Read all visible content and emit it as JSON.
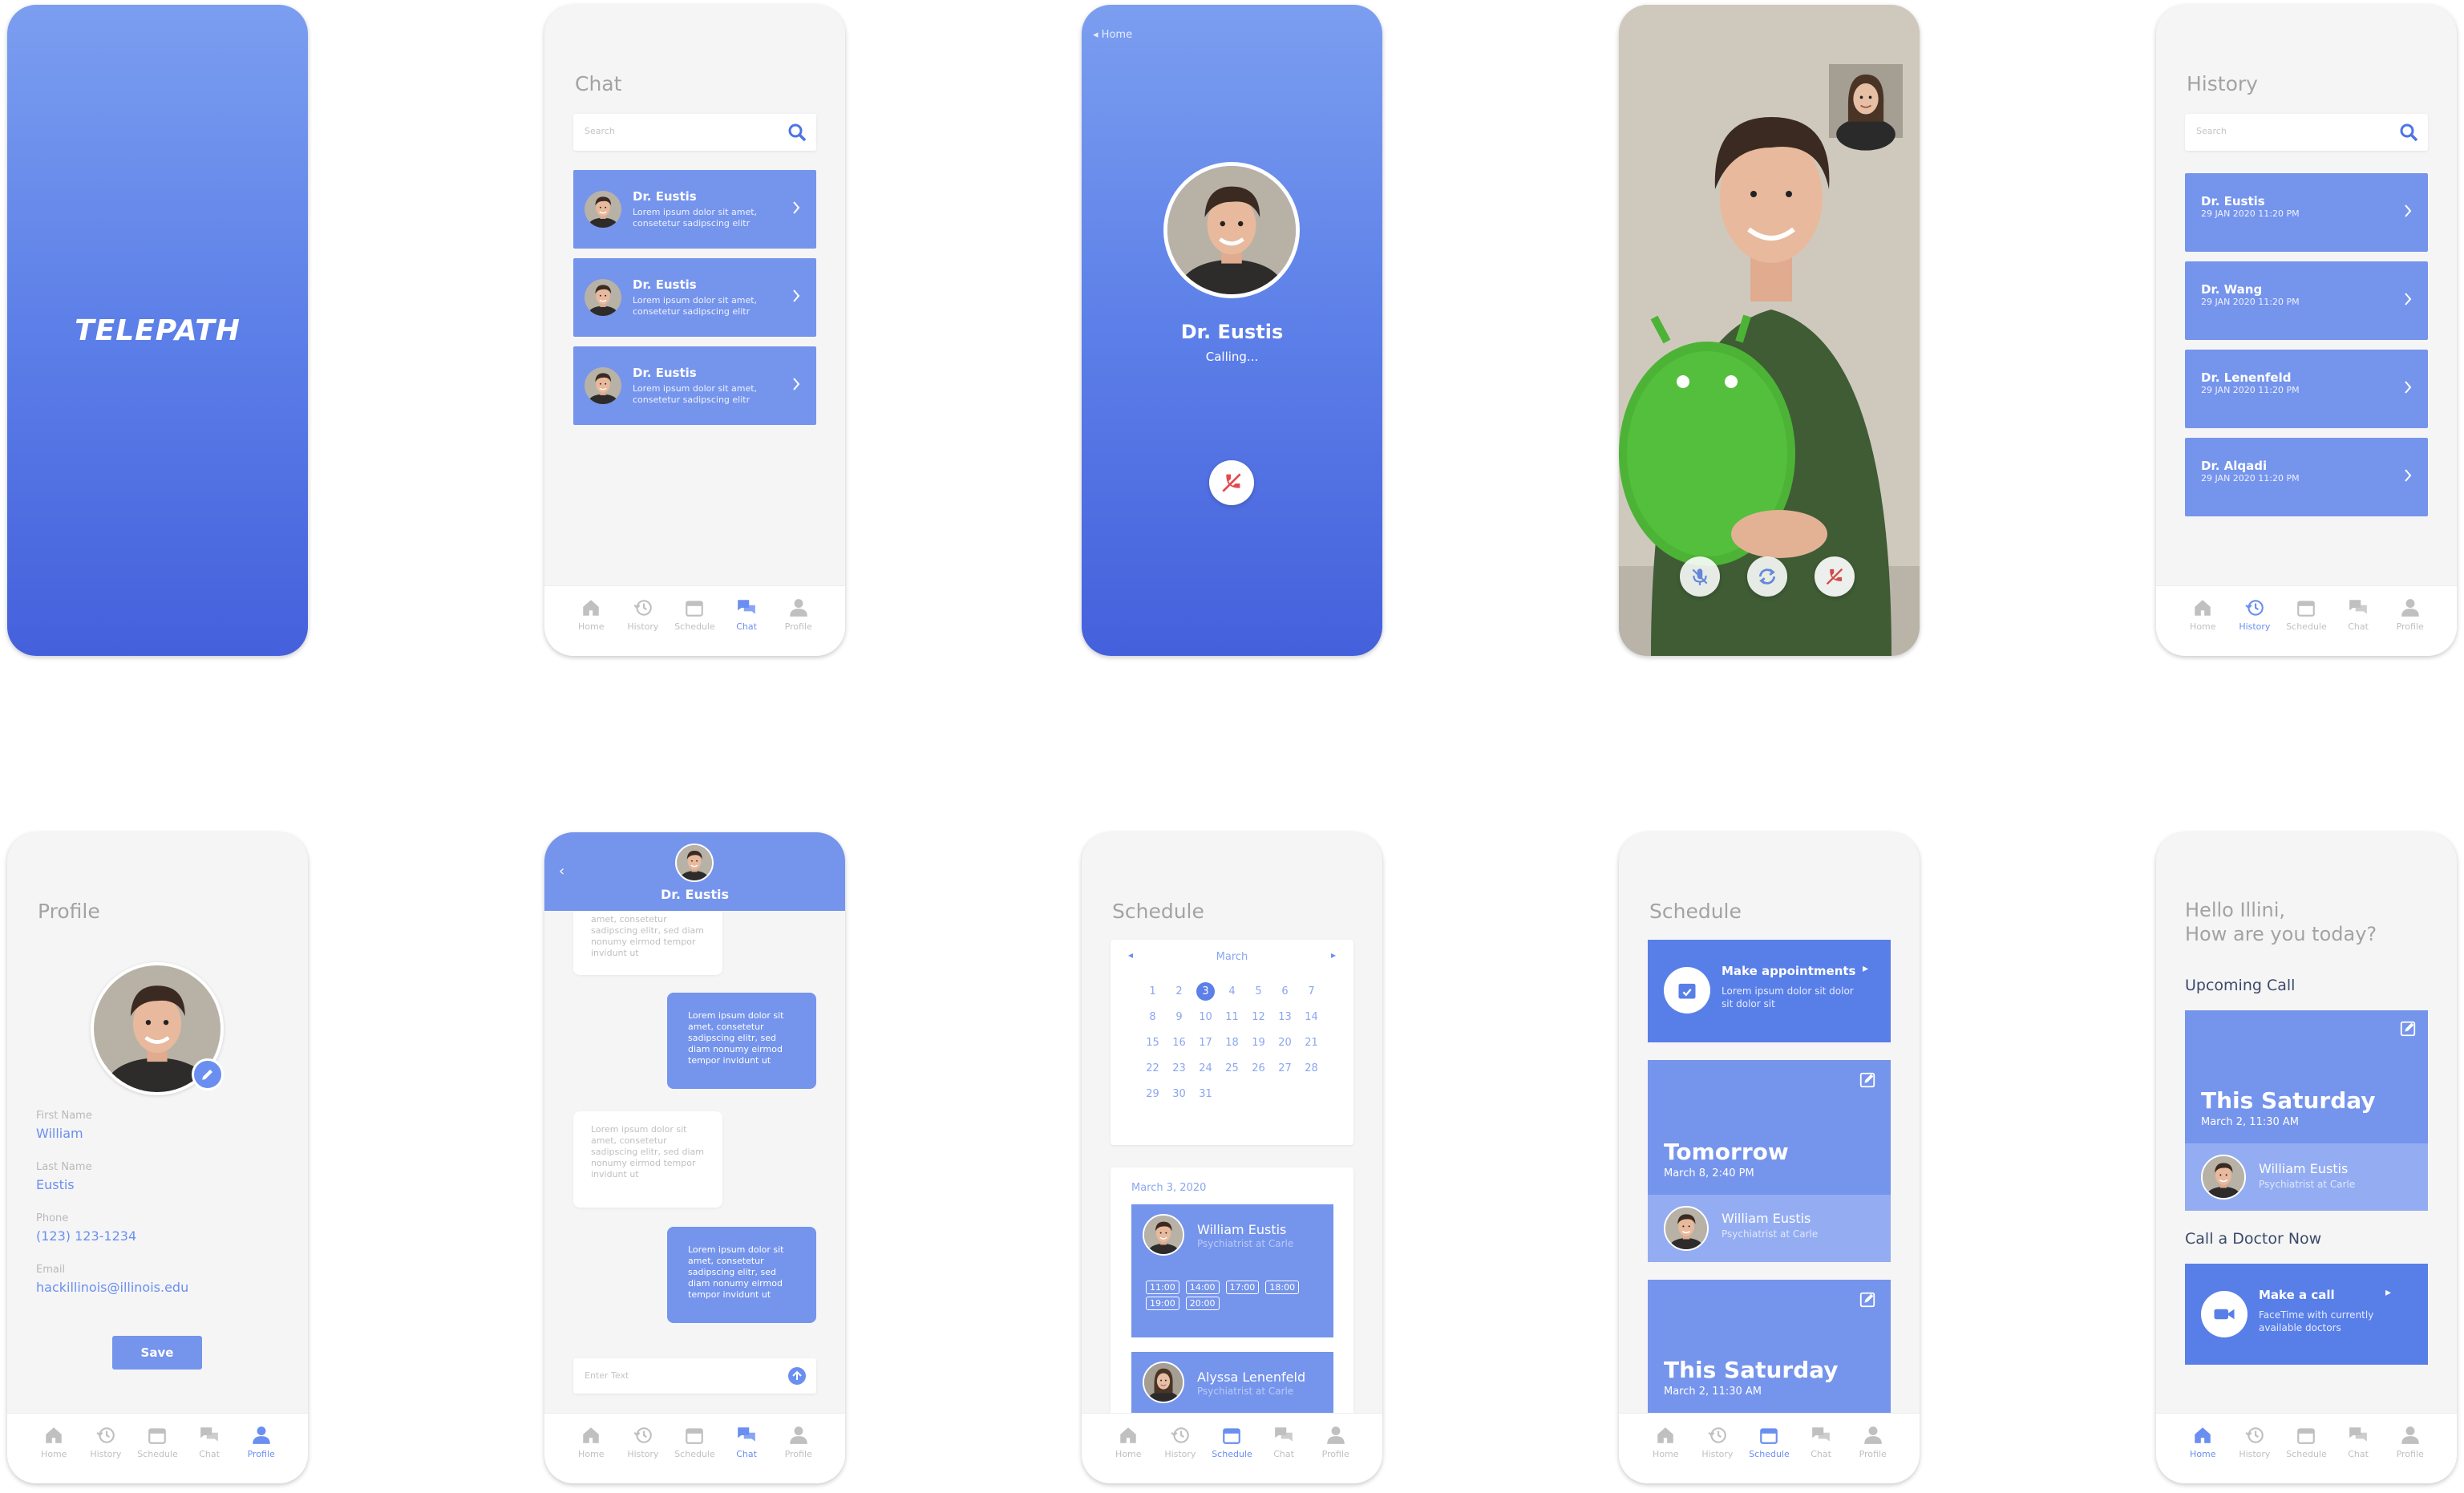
{
  "colors": {
    "accent": "#6a8ff0",
    "card": "#7594ec",
    "decline": "#e5484d"
  },
  "nav": {
    "home": "Home",
    "history": "History",
    "schedule": "Schedule",
    "chat": "Chat",
    "profile": "Profile"
  },
  "splash": {
    "logo": "TELEPATH"
  },
  "chat": {
    "title": "Chat",
    "search_placeholder": "Search",
    "items": [
      {
        "name": "Dr. Eustis",
        "preview": "Lorem ipsum dolor sit amet, consetetur sadipscing elitr"
      },
      {
        "name": "Dr. Eustis",
        "preview": "Lorem ipsum dolor sit amet, consetetur sadipscing elitr"
      },
      {
        "name": "Dr. Eustis",
        "preview": "Lorem ipsum dolor sit amet, consetetur sadipscing elitr"
      }
    ]
  },
  "calling": {
    "back": "Home",
    "name": "Dr. Eustis",
    "status": "Calling..."
  },
  "history": {
    "title": "History",
    "search_placeholder": "Search",
    "items": [
      {
        "name": "Dr. Eustis",
        "date": "29 JAN 2020 11:20 PM"
      },
      {
        "name": "Dr. Wang",
        "date": "29 JAN 2020 11:20 PM"
      },
      {
        "name": "Dr. Lenenfeld",
        "date": "29 JAN 2020 11:20 PM"
      },
      {
        "name": "Dr. Alqadi",
        "date": "29 JAN 2020 11:20 PM"
      }
    ]
  },
  "profile": {
    "title": "Profile",
    "first_label": "First Name",
    "first": "William",
    "last_label": "Last Name",
    "last": "Eustis",
    "phone_label": "Phone",
    "phone": "(123) 123-1234",
    "email_label": "Email",
    "email": "hackillinois@illinois.edu",
    "save": "Save"
  },
  "conversation": {
    "name": "Dr. Eustis",
    "partial": "amet, consetetur sadipscing elitr, sed diam nonumy eirmod tempor invidunt ut",
    "msg": "Lorem ipsum dolor sit amet, consetetur sadipscing elitr, sed diam nonumy eirmod tempor invidunt ut",
    "input_placeholder": "Enter Text"
  },
  "schedule": {
    "title": "Schedule",
    "month": "March",
    "weeks": [
      [
        "1",
        "2",
        "3",
        "4",
        "5",
        "6",
        "7"
      ],
      [
        "8",
        "9",
        "10",
        "11",
        "12",
        "13",
        "14"
      ],
      [
        "15",
        "16",
        "17",
        "18",
        "19",
        "20",
        "21"
      ],
      [
        "22",
        "23",
        "24",
        "25",
        "26",
        "27",
        "28"
      ],
      [
        "29",
        "30",
        "31",
        "",
        "",
        "",
        ""
      ]
    ],
    "selected_day": "3",
    "date_label": "March 3, 2020",
    "doctors": [
      {
        "name": "William Eustis",
        "role": "Psychiatrist at Carle",
        "times": [
          "11:00",
          "14:00",
          "17:00",
          "18:00",
          "19:00",
          "20:00"
        ]
      },
      {
        "name": "Alyssa Lenenfeld",
        "role": "Psychiatrist at Carle"
      }
    ]
  },
  "schedule2": {
    "title": "Schedule",
    "make_title": "Make appointments",
    "make_sub": "Lorem ipsum dolor sit dolor sit dolor sit",
    "appt1": {
      "day": "Tomorrow",
      "when": "March 8, 2:40 PM",
      "doc": "William Eustis",
      "role": "Psychiatrist at Carle"
    },
    "appt2": {
      "day": "This Saturday",
      "when": "March 2, 11:30 AM"
    }
  },
  "home": {
    "greeting1": "Hello Illini,",
    "greeting2": "How are you today?",
    "upcoming": "Upcoming Call",
    "day": "This Saturday",
    "when": "March 2, 11:30 AM",
    "doc": "William Eustis",
    "role": "Psychiatrist at Carle",
    "call_now": "Call a Doctor Now",
    "call_title": "Make a call",
    "call_sub": "FaceTime with currently available doctors"
  }
}
